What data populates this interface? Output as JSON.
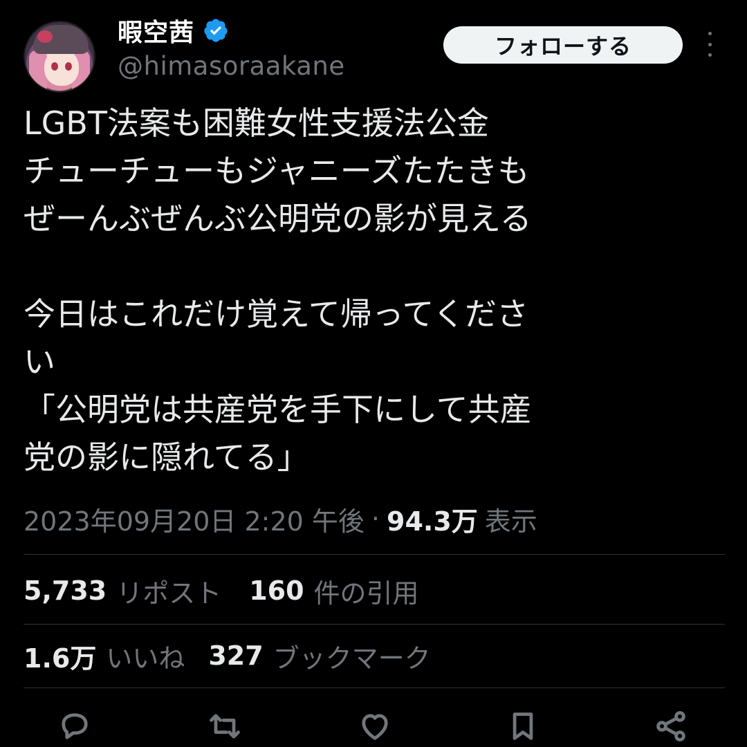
{
  "user": {
    "display_name": "暇空茜",
    "handle": "@himasoraakane",
    "verified": true
  },
  "header": {
    "follow_label": "フォローする",
    "more_icon": "more-vertical-icon"
  },
  "tweet": {
    "text": "LGBT法案も困難女性支援法公金\nチューチューもジャニーズたたきも\nぜーんぶぜんぶ公明党の影が見える\n\n今日はこれだけ覚えて帰ってくださ\nい\n「公明党は共産党を手下にして共産\n党の影に隠れてる」",
    "timestamp": "2023年09月20日 2:20 午後",
    "separator": "·",
    "views_count": "94.3万",
    "views_label": "表示"
  },
  "stats": {
    "reposts_count": "5,733",
    "reposts_label": "リポスト",
    "quotes_count": "160",
    "quotes_label": "件の引用",
    "likes_count": "1.6万",
    "likes_label": "いいね",
    "bookmarks_count": "327",
    "bookmarks_label": "ブックマーク"
  },
  "actions": [
    "reply-icon",
    "repost-icon",
    "like-icon",
    "bookmark-icon",
    "share-icon"
  ],
  "colors": {
    "background": "#000000",
    "text": "#e7e9ea",
    "muted": "#71767b",
    "verified": "#1d9bf0",
    "divider": "#2f3336"
  }
}
